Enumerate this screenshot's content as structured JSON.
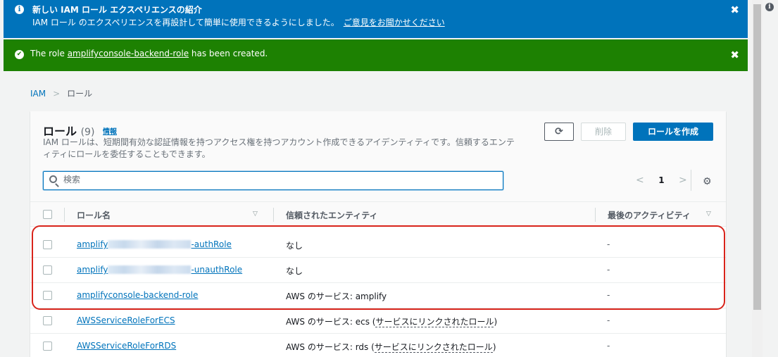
{
  "banner_info": {
    "title": "新しい IAM ロール エクスペリエンスの紹介",
    "description": "IAM ロール のエクスペリエンスを再設計して簡単に使用できるようにしました。",
    "feedback_link": "ご意見をお聞かせください",
    "icon": "info-icon",
    "close": "✖"
  },
  "banner_success": {
    "prefix": "The role ",
    "role_link": "amplifyconsole-backend-role",
    "suffix": " has been created.",
    "icon": "check-icon",
    "close": "✖"
  },
  "breadcrumb": {
    "root": "IAM",
    "separator": ">",
    "current": "ロール"
  },
  "panel": {
    "title": "ロール",
    "count": "(9)",
    "info_link": "情報",
    "description": "IAM ロールは、短期間有効な認証情報を持つアクセス権を持つアカウント作成できるアイデンティティです。信頼するエンティティにロールを委任することもできます。",
    "buttons": {
      "refresh": "⟳",
      "delete": "削除",
      "create": "ロールを作成"
    },
    "search": {
      "placeholder": "検索"
    },
    "pagination": {
      "prev": "<",
      "page": "1",
      "next": ">"
    },
    "settings_icon": "⚙"
  },
  "table": {
    "columns": [
      "ロール名",
      "信頼されたエンティティ",
      "最後のアクティビティ"
    ],
    "rows": [
      {
        "name_prefix": "amplify",
        "name_suffix": "-authRole",
        "trust": "なし",
        "trust_link": "",
        "trust_close": "",
        "activity": "-"
      },
      {
        "name_prefix": "amplify",
        "name_suffix": "-unauthRole",
        "trust": "なし",
        "trust_link": "",
        "trust_close": "",
        "activity": "-"
      },
      {
        "name_prefix": "amplifyconsole-backend-role",
        "name_suffix": "",
        "trust": "AWS のサービス: amplify",
        "trust_link": "",
        "trust_close": "",
        "activity": "-"
      },
      {
        "name_prefix": "AWSServiceRoleForECS",
        "name_suffix": "",
        "trust": "AWS のサービス: ecs (",
        "trust_link": "サービスにリンクされたロール",
        "trust_close": ")",
        "activity": "-"
      },
      {
        "name_prefix": "AWSServiceRoleForRDS",
        "name_suffix": "",
        "trust": "AWS のサービス: rds (",
        "trust_link": "サービスにリンクされたロール",
        "trust_close": ")",
        "activity": "-"
      }
    ]
  },
  "colors": {
    "info_banner": "#0073bb",
    "success_banner": "#1d8102",
    "primary_button": "#0073bb",
    "link": "#0073bb",
    "highlight": "#d8241b"
  }
}
